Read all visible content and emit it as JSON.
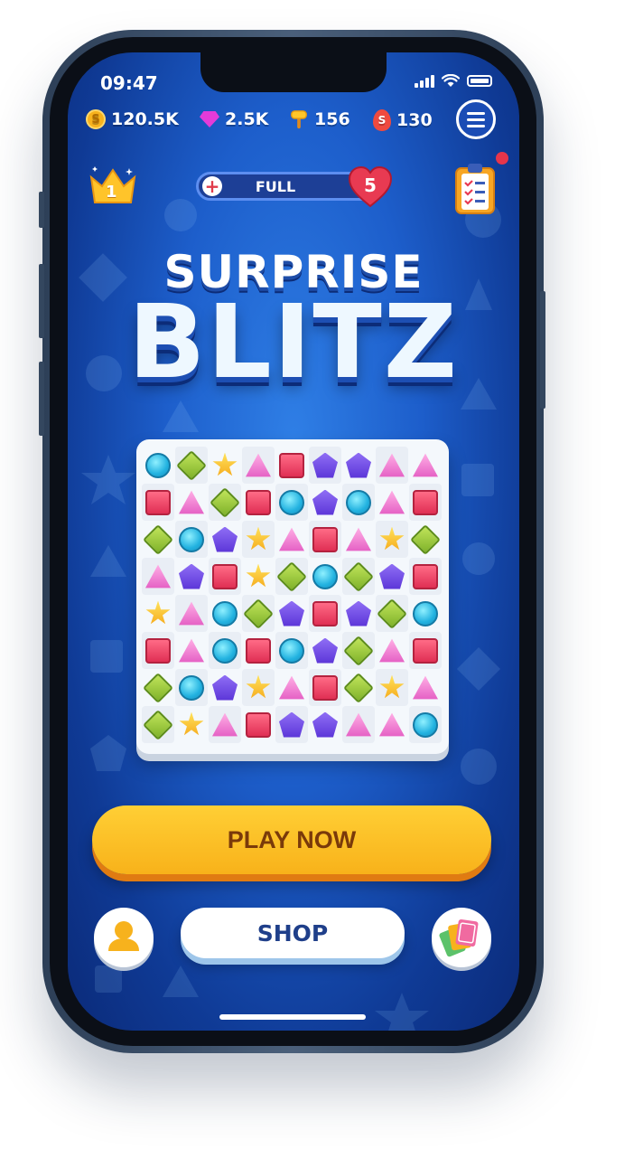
{
  "status_bar": {
    "time": "09:47"
  },
  "resources": {
    "coins": "120.5K",
    "gems": "2.5K",
    "hammers": "156",
    "eggs": "130",
    "coin_symbol": "S",
    "egg_symbol": "S"
  },
  "level": {
    "value": "1"
  },
  "lives": {
    "status": "FULL",
    "count": "5",
    "add_symbol": "+"
  },
  "title": {
    "line1": "SURPRISE",
    "line2": "BLITZ"
  },
  "board": {
    "rows": [
      [
        "blue",
        "green",
        "yellow",
        "pink",
        "red",
        "purple",
        "purple",
        "pink",
        "pink"
      ],
      [
        "red",
        "pink",
        "green",
        "red",
        "blue",
        "purple",
        "blue",
        "pink",
        "red"
      ],
      [
        "green",
        "blue",
        "purple",
        "yellow",
        "pink",
        "red",
        "pink",
        "yellow",
        "green"
      ],
      [
        "pink",
        "purple",
        "red",
        "yellow",
        "green",
        "blue",
        "green",
        "purple",
        "red"
      ],
      [
        "yellow",
        "pink",
        "blue",
        "green",
        "purple",
        "red",
        "purple",
        "green",
        "blue"
      ],
      [
        "red",
        "pink",
        "blue",
        "red",
        "blue",
        "purple",
        "green",
        "pink",
        "red"
      ],
      [
        "green",
        "blue",
        "purple",
        "yellow",
        "pink",
        "red",
        "green",
        "yellow",
        "pink"
      ],
      [
        "green",
        "yellow",
        "pink",
        "red",
        "purple",
        "purple",
        "pink",
        "pink",
        "blue"
      ]
    ]
  },
  "buttons": {
    "play": "PLAY NOW",
    "shop": "SHOP"
  },
  "colors": {
    "accent": "#f8b21a",
    "background": "#1d5ecb",
    "shop_text": "#1f3f8a"
  }
}
